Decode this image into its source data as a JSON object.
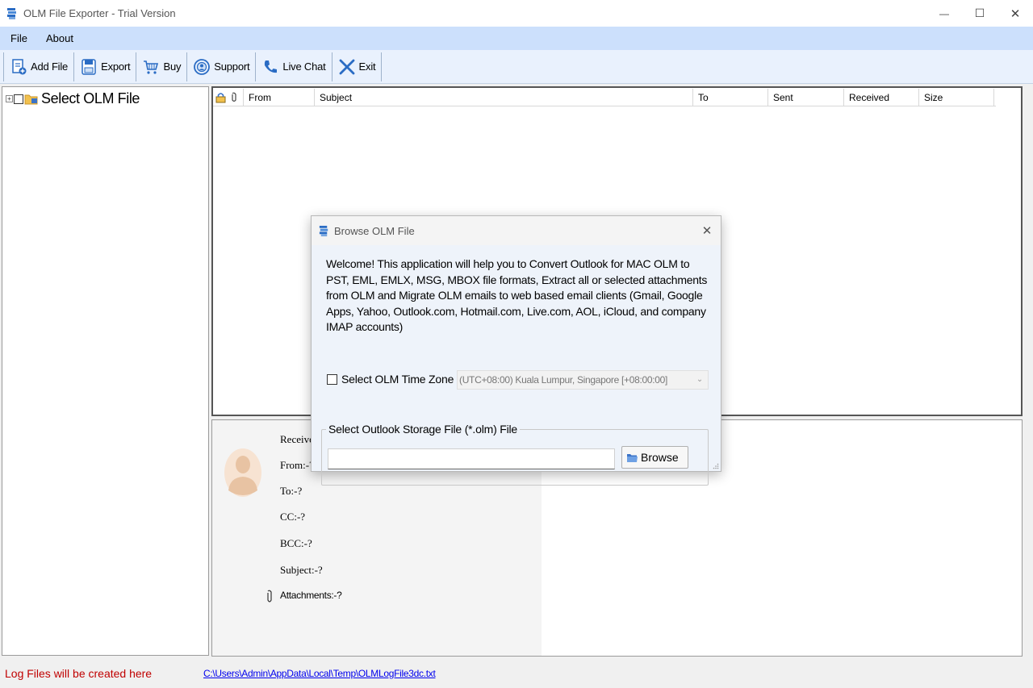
{
  "window": {
    "title": "OLM File Exporter - Trial Version",
    "minimize_glyph": "—",
    "maximize_glyph": "☐",
    "close_glyph": "✕"
  },
  "menu": {
    "items": [
      {
        "label": "File"
      },
      {
        "label": "About"
      }
    ]
  },
  "toolbar": {
    "buttons": [
      {
        "label": "Add File",
        "icon": "add-file-icon"
      },
      {
        "label": "Export",
        "icon": "export-icon"
      },
      {
        "label": "Buy",
        "icon": "cart-icon"
      },
      {
        "label": "Support",
        "icon": "support-icon"
      },
      {
        "label": "Live Chat",
        "icon": "phone-icon"
      },
      {
        "label": "Exit",
        "icon": "exit-icon"
      }
    ]
  },
  "tree": {
    "root_label": "Select OLM File",
    "expander_glyph": "+"
  },
  "mail_list": {
    "columns": [
      "From",
      "Subject",
      "To",
      "Sent",
      "Received",
      "Size"
    ]
  },
  "preview": {
    "received": "Received:-?",
    "from": "From:-?",
    "to": "To:-?",
    "cc": "CC:-?",
    "bcc": "BCC:-?",
    "subject": "Subject:-?",
    "attachments": "Attachments:-?"
  },
  "status": {
    "label": "Log Files will be created here",
    "log_path": "C:\\Users\\Admin\\AppData\\Local\\Temp\\OLMLogFile3dc.txt"
  },
  "dialog": {
    "title": "Browse OLM File",
    "close_glyph": "✕",
    "description": "Welcome! This application will help you to Convert Outlook for MAC OLM to PST, EML, EMLX, MSG, MBOX file formats, Extract all or selected attachments from OLM and Migrate OLM emails to web based email clients (Gmail, Google Apps, Yahoo, Outlook.com, Hotmail.com, Live.com, AOL, iCloud, and company IMAP accounts)",
    "timezone_label": "Select OLM Time Zone",
    "timezone_value": "(UTC+08:00) Kuala Lumpur, Singapore  [+08:00:00]",
    "timezone_checked": false,
    "group_label": "Select Outlook Storage File (*.olm) File",
    "file_value": "",
    "browse_label": "Browse"
  },
  "colors": {
    "menu_bg": "#cce0fc",
    "toolbar_bg": "#e9f1fd",
    "status_text": "#c00000",
    "link": "#0000ee",
    "accent_blue": "#2a6cc4"
  }
}
